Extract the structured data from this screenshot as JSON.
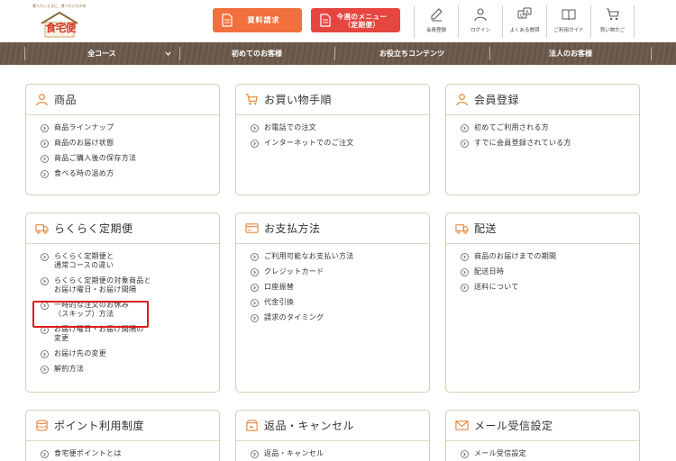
{
  "header": {
    "logo": {
      "tagline": "食べたいときに、食べたいものを",
      "brand": "食宅便"
    },
    "brochure_button": "資料請求",
    "menu_button": {
      "line1": "今週のメニュー",
      "line2": "（定期便）"
    },
    "nav_icons": [
      {
        "label": "会員登録",
        "icon": "pen-icon"
      },
      {
        "label": "ログイン",
        "icon": "person-icon"
      },
      {
        "label": "よくある質問",
        "icon": "question-chat-icon"
      },
      {
        "label": "ご利用ガイド",
        "icon": "book-icon"
      },
      {
        "label": "買い物かご",
        "icon": "cart-icon"
      }
    ]
  },
  "category_bar": {
    "items": [
      "全コース",
      "初めてのお客様",
      "お役立ちコンテンツ",
      "法人のお客様"
    ]
  },
  "cards": [
    {
      "title": "商品",
      "icon": "person-icon",
      "links": [
        [
          "商品ラインナップ"
        ],
        [
          "商品のお届け状態"
        ],
        [
          "商品ご購入後の保存方法"
        ],
        [
          "食べる時の温め方"
        ]
      ]
    },
    {
      "title": "お買い物手順",
      "icon": "cart-icon",
      "links": [
        [
          "お電話での注文"
        ],
        [
          "インターネットでのご注文"
        ]
      ]
    },
    {
      "title": "会員登録",
      "icon": "person-icon",
      "links": [
        [
          "初めてご利用される方"
        ],
        [
          "すでに会員登録されている方"
        ]
      ]
    },
    {
      "title": "らくらく定期便",
      "icon": "truck-icon",
      "links": [
        [
          "らくらく定期便と",
          "通常コースの違い"
        ],
        [
          "らくらく定期便の対象商品と",
          "お届け曜日・お届け間隔"
        ],
        [
          "一時的な注文のお休み",
          "（スキップ）方法"
        ],
        [
          "お届け曜日・お届け間隔の",
          "変更"
        ],
        [
          "お届け先の変更"
        ],
        [
          "解約方法"
        ]
      ]
    },
    {
      "title": "お支払方法",
      "icon": "card-icon",
      "links": [
        [
          "ご利用可能なお支払い方法"
        ],
        [
          "クレジットカード"
        ],
        [
          "口座振替"
        ],
        [
          "代金引換"
        ],
        [
          "請求のタイミング"
        ]
      ]
    },
    {
      "title": "配送",
      "icon": "truck-icon",
      "links": [
        [
          "商品のお届けまでの期間"
        ],
        [
          "配送日時"
        ],
        [
          "送料について"
        ]
      ]
    },
    {
      "title": "ポイント利用制度",
      "icon": "coins-icon",
      "links": [
        [
          "食宅便ポイントとは"
        ]
      ]
    },
    {
      "title": "返品・キャンセル",
      "icon": "return-box-icon",
      "links": [
        [
          "返品・キャンセル"
        ]
      ]
    },
    {
      "title": "メール受信設定",
      "icon": "mail-icon",
      "links": [
        [
          "メール受信設定"
        ]
      ]
    }
  ],
  "colors": {
    "accent_orange": "#f2703e",
    "accent_red": "#e5463f",
    "category_bar": "#6b5a4a",
    "icon_orange": "#e8873a",
    "highlight_red": "#e0191e"
  }
}
